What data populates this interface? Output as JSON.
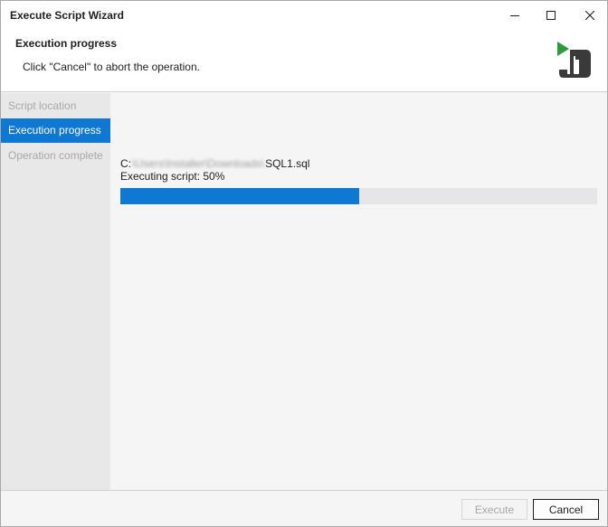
{
  "window": {
    "title": "Execute Script Wizard",
    "controls": [
      "minimize-icon",
      "maximize-icon",
      "close-icon"
    ]
  },
  "header": {
    "title": "Execution progress",
    "subtitle": "Click \"Cancel\" to abort the operation."
  },
  "sidebar": {
    "steps": [
      {
        "label": "Script location",
        "state": "disabled"
      },
      {
        "label": "Execution progress",
        "state": "active"
      },
      {
        "label": "Operation complete",
        "state": "disabled"
      }
    ]
  },
  "main": {
    "path_prefix": "C:",
    "path_obscured": "\\Users\\Installer\\Downloads\\",
    "path_file": "SQL1.sql",
    "status": "Executing script: 50%",
    "progress": 0.5
  },
  "footer": {
    "execute_label": "Execute",
    "cancel_label": "Cancel"
  },
  "colors": {
    "accent": "#0f78d2",
    "track": "#e6e6e9",
    "sidebar_bg": "#e8e8e8"
  }
}
